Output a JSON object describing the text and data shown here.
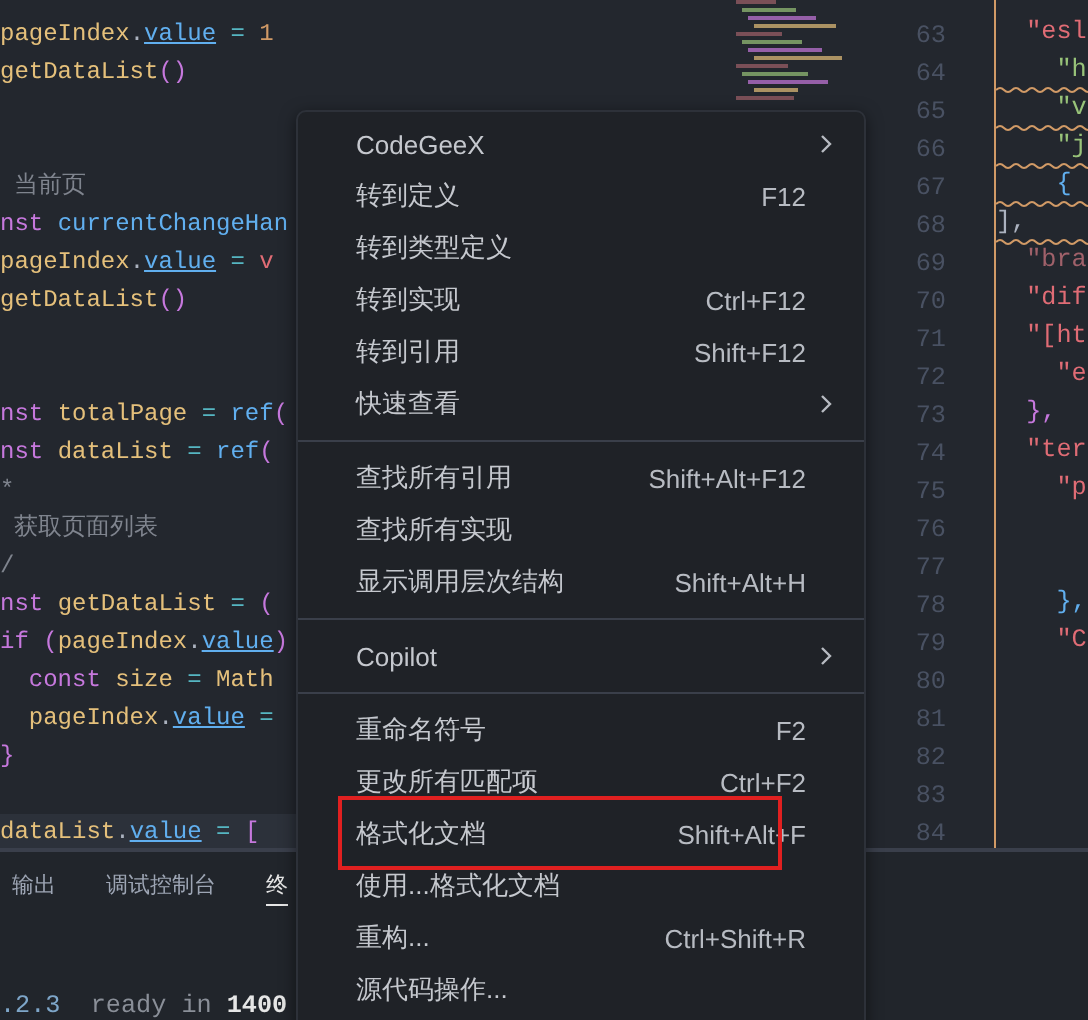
{
  "left_code": [
    {
      "kind": "code",
      "current": false,
      "tokens": [
        {
          "t": "pageIndex",
          "kind": "var"
        },
        {
          "t": ".",
          "kind": "punct"
        },
        {
          "t": "value",
          "kind": "prop"
        },
        {
          "t": " = ",
          "kind": "op"
        },
        {
          "t": "1",
          "kind": "num"
        }
      ]
    },
    {
      "kind": "code",
      "current": false,
      "tokens": [
        {
          "t": "getDataList",
          "kind": "fn"
        },
        {
          "t": "()",
          "kind": "paren"
        }
      ]
    },
    {
      "kind": "blank",
      "current": false
    },
    {
      "kind": "blank",
      "current": false
    },
    {
      "kind": "code",
      "current": false,
      "tokens": [
        {
          "t": " 当前页",
          "kind": "comment"
        }
      ]
    },
    {
      "kind": "code",
      "current": false,
      "tokens": [
        {
          "t": "nst ",
          "kind": "kw"
        },
        {
          "t": "currentChangeHan",
          "kind": "call"
        }
      ]
    },
    {
      "kind": "code",
      "current": false,
      "tokens": [
        {
          "t": "pageIndex",
          "kind": "var"
        },
        {
          "t": ".",
          "kind": "punct"
        },
        {
          "t": "value",
          "kind": "prop"
        },
        {
          "t": " = ",
          "kind": "op"
        },
        {
          "t": "v",
          "kind": "param"
        }
      ]
    },
    {
      "kind": "code",
      "current": false,
      "tokens": [
        {
          "t": "getDataList",
          "kind": "fn"
        },
        {
          "t": "()",
          "kind": "paren"
        }
      ]
    },
    {
      "kind": "blank",
      "current": false
    },
    {
      "kind": "blank",
      "current": false
    },
    {
      "kind": "code",
      "current": false,
      "tokens": [
        {
          "t": "nst ",
          "kind": "kw"
        },
        {
          "t": "totalPage",
          "kind": "var"
        },
        {
          "t": " = ",
          "kind": "op"
        },
        {
          "t": "ref",
          "kind": "call"
        },
        {
          "t": "(",
          "kind": "paren"
        }
      ]
    },
    {
      "kind": "code",
      "current": false,
      "tokens": [
        {
          "t": "nst ",
          "kind": "kw"
        },
        {
          "t": "dataList",
          "kind": "var"
        },
        {
          "t": " = ",
          "kind": "op"
        },
        {
          "t": "ref",
          "kind": "call"
        },
        {
          "t": "(",
          "kind": "paren"
        }
      ]
    },
    {
      "kind": "code",
      "current": false,
      "tokens": [
        {
          "t": "*",
          "kind": "comment"
        }
      ]
    },
    {
      "kind": "code",
      "current": false,
      "tokens": [
        {
          "t": " 获取页面列表",
          "kind": "comment"
        }
      ]
    },
    {
      "kind": "code",
      "current": false,
      "tokens": [
        {
          "t": "/",
          "kind": "comment"
        }
      ]
    },
    {
      "kind": "code",
      "current": false,
      "tokens": [
        {
          "t": "nst ",
          "kind": "kw"
        },
        {
          "t": "getDataList",
          "kind": "fn"
        },
        {
          "t": " = ",
          "kind": "op"
        },
        {
          "t": "(",
          "kind": "paren"
        }
      ]
    },
    {
      "kind": "code",
      "current": false,
      "tokens": [
        {
          "t": "if ",
          "kind": "kw"
        },
        {
          "t": "(",
          "kind": "paren"
        },
        {
          "t": "pageIndex",
          "kind": "var"
        },
        {
          "t": ".",
          "kind": "punct"
        },
        {
          "t": "value",
          "kind": "prop"
        },
        {
          "t": ")",
          "kind": "paren"
        }
      ]
    },
    {
      "kind": "code",
      "current": false,
      "tokens": [
        {
          "t": "  const ",
          "kind": "kw"
        },
        {
          "t": "size",
          "kind": "var"
        },
        {
          "t": " = ",
          "kind": "op"
        },
        {
          "t": "Math",
          "kind": "var"
        }
      ]
    },
    {
      "kind": "code",
      "current": false,
      "tokens": [
        {
          "t": "  pageIndex",
          "kind": "var"
        },
        {
          "t": ".",
          "kind": "punct"
        },
        {
          "t": "value",
          "kind": "prop"
        },
        {
          "t": " =",
          "kind": "op"
        }
      ]
    },
    {
      "kind": "code",
      "current": false,
      "tokens": [
        {
          "t": "}",
          "kind": "paren"
        }
      ]
    },
    {
      "kind": "blank",
      "current": false
    },
    {
      "kind": "code",
      "current": true,
      "tokens": [
        {
          "t": "dataList",
          "kind": "var"
        },
        {
          "t": ".",
          "kind": "punct"
        },
        {
          "t": "value",
          "kind": "prop"
        },
        {
          "t": " = ",
          "kind": "op"
        },
        {
          "t": "[",
          "kind": "paren"
        }
      ]
    }
  ],
  "right_code": [
    {
      "number": "63",
      "warning": false,
      "tokens": [
        {
          "t": "  \"esl",
          "kind": "str"
        }
      ]
    },
    {
      "number": "64",
      "warning": true,
      "tokens": [
        {
          "t": "    \"h",
          "kind": "green"
        }
      ]
    },
    {
      "number": "65",
      "warning": true,
      "tokens": [
        {
          "t": "    \"v",
          "kind": "green"
        }
      ]
    },
    {
      "number": "66",
      "warning": true,
      "tokens": [
        {
          "t": "    \"j",
          "kind": "green"
        }
      ]
    },
    {
      "number": "67",
      "warning": true,
      "tokens": [
        {
          "t": "    {",
          "kind": "call"
        }
      ]
    },
    {
      "number": "68",
      "warning": true,
      "tokens": [
        {
          "t": "],",
          "kind": "punct"
        }
      ]
    },
    {
      "number": "69",
      "warning": false,
      "tokens": [
        {
          "t": "  \"bra",
          "kind": "dimstr"
        }
      ]
    },
    {
      "number": "70",
      "warning": false,
      "tokens": [
        {
          "t": "  \"dif",
          "kind": "str"
        }
      ]
    },
    {
      "number": "71",
      "warning": false,
      "tokens": [
        {
          "t": "  \"[ht",
          "kind": "str"
        }
      ]
    },
    {
      "number": "72",
      "warning": false,
      "tokens": [
        {
          "t": "    \"e",
          "kind": "str"
        }
      ]
    },
    {
      "number": "73",
      "warning": false,
      "tokens": [
        {
          "t": "  },",
          "kind": "paren"
        }
      ]
    },
    {
      "number": "74",
      "warning": false,
      "tokens": [
        {
          "t": "  \"ter",
          "kind": "str"
        }
      ]
    },
    {
      "number": "75",
      "warning": false,
      "tokens": [
        {
          "t": "    \"p",
          "kind": "str"
        }
      ]
    },
    {
      "number": "76",
      "warning": false
    },
    {
      "number": "77",
      "warning": false
    },
    {
      "number": "78",
      "warning": false,
      "tokens": [
        {
          "t": "    },",
          "kind": "call"
        }
      ]
    },
    {
      "number": "79",
      "warning": false,
      "tokens": [
        {
          "t": "    \"C",
          "kind": "str"
        }
      ]
    },
    {
      "number": "80",
      "warning": false
    },
    {
      "number": "81",
      "warning": false
    },
    {
      "number": "82",
      "warning": false
    },
    {
      "number": "83",
      "warning": false
    },
    {
      "number": "84",
      "warning": false
    }
  ],
  "panel": {
    "tabs": [
      {
        "label": "输出",
        "selected": false
      },
      {
        "label": "调试控制台",
        "selected": false
      },
      {
        "label": "终",
        "selected": true
      }
    ],
    "terminal": [
      {
        "t": ".2.3",
        "kind": "ver"
      },
      {
        "t": "  ready in ",
        "kind": "dim"
      },
      {
        "t": "1400",
        "kind": "bold"
      }
    ]
  },
  "context_menu": [
    {
      "kind": "item",
      "label": "CodeGeeX",
      "submenu": true,
      "highlighted": false
    },
    {
      "kind": "item",
      "label": "转到定义",
      "shortcut": "F12",
      "submenu": false,
      "highlighted": false
    },
    {
      "kind": "item",
      "label": "转到类型定义",
      "submenu": false,
      "highlighted": false
    },
    {
      "kind": "item",
      "label": "转到实现",
      "shortcut": "Ctrl+F12",
      "submenu": false,
      "highlighted": false
    },
    {
      "kind": "item",
      "label": "转到引用",
      "shortcut": "Shift+F12",
      "submenu": false,
      "highlighted": false
    },
    {
      "kind": "item",
      "label": "快速查看",
      "submenu": true,
      "highlighted": false
    },
    {
      "kind": "separator"
    },
    {
      "kind": "item",
      "label": "查找所有引用",
      "shortcut": "Shift+Alt+F12",
      "submenu": false,
      "highlighted": false
    },
    {
      "kind": "item",
      "label": "查找所有实现",
      "submenu": false,
      "highlighted": false
    },
    {
      "kind": "item",
      "label": "显示调用层次结构",
      "shortcut": "Shift+Alt+H",
      "submenu": false,
      "highlighted": false
    },
    {
      "kind": "separator"
    },
    {
      "kind": "item",
      "label": "Copilot",
      "submenu": true,
      "highlighted": false
    },
    {
      "kind": "separator"
    },
    {
      "kind": "item",
      "label": "重命名符号",
      "shortcut": "F2",
      "submenu": false,
      "highlighted": false
    },
    {
      "kind": "item",
      "label": "更改所有匹配项",
      "shortcut": "Ctrl+F2",
      "submenu": false,
      "highlighted": false
    },
    {
      "kind": "item",
      "label": "格式化文档",
      "shortcut": "Shift+Alt+F",
      "submenu": false,
      "highlighted": true
    },
    {
      "kind": "item",
      "label": "使用...格式化文档",
      "submenu": false,
      "highlighted": false
    },
    {
      "kind": "item",
      "label": "重构...",
      "shortcut": "Ctrl+Shift+R",
      "submenu": false,
      "highlighted": false
    },
    {
      "kind": "item",
      "label": "源代码操作...",
      "submenu": false,
      "highlighted": false
    }
  ]
}
